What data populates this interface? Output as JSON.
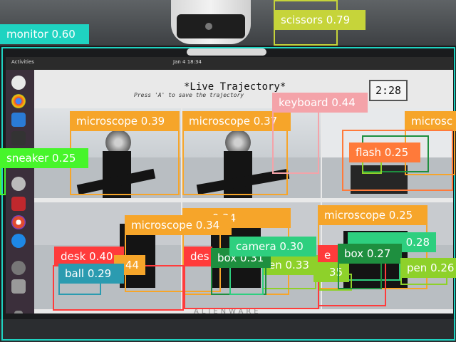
{
  "scene": {
    "live_title": "*Live Trajectory*",
    "live_subtitle": "Press 'A' to save the trajectory",
    "timer": "2:28",
    "topbar_left": "Activities",
    "topbar_clock": "Jan 4  18:34",
    "laptop_brand": "ALIENWARE"
  },
  "colors": {
    "monitor": "#1fd3c1",
    "scissors": "#c6d43a",
    "microscope": "#f6a52a",
    "keyboard": "#f4a3a9",
    "sneaker": "#47f52b",
    "flash": "#ff7a3a",
    "desk": "#ff3b3b",
    "ball": "#2b9bb0",
    "box": "#1e8f3f",
    "camera": "#2ecf7f",
    "pen": "#8ed12a"
  },
  "detections": [
    {
      "id": "monitor",
      "label": "monitor 0.60",
      "class": "monitor"
    },
    {
      "id": "scissors",
      "label": "scissors 0.79",
      "class": "scissors"
    },
    {
      "id": "microscope-1",
      "label": "microscope 0.39",
      "class": "microscope"
    },
    {
      "id": "microscope-2",
      "label": "microscope 0.37",
      "class": "microscope"
    },
    {
      "id": "keyboard",
      "label": "keyboard 0.44",
      "class": "keyboard"
    },
    {
      "id": "microscope-3",
      "label": "microsc",
      "class": "microscope"
    },
    {
      "id": "sneaker",
      "label": "sneaker 0.25",
      "class": "sneaker"
    },
    {
      "id": "flash",
      "label": "flash 0.25",
      "class": "flash"
    },
    {
      "id": "microscope-4",
      "label": "ope 0.34",
      "class": "microscope"
    },
    {
      "id": "microscope-5",
      "label": "microscope 0.25",
      "class": "microscope"
    },
    {
      "id": "microscope-6",
      "label": "microscope 0.34",
      "class": "microscope"
    },
    {
      "id": "camera-1",
      "label": "camera 0.30",
      "class": "camera"
    },
    {
      "id": "camera-2",
      "label": "0.28",
      "class": "camera"
    },
    {
      "id": "desk-1",
      "label": "desk 0.40",
      "class": "desk"
    },
    {
      "id": "microscope-7",
      "label": "44",
      "class": "microscope"
    },
    {
      "id": "desk-2",
      "label": "des",
      "class": "desk"
    },
    {
      "id": "box-1",
      "label": "box 0.31",
      "class": "box"
    },
    {
      "id": "pen-1",
      "label": "en 0.33",
      "class": "pen"
    },
    {
      "id": "desk-3",
      "label": "e",
      "class": "desk"
    },
    {
      "id": "pen-2",
      "label": "35",
      "class": "pen"
    },
    {
      "id": "box-2",
      "label": "box 0.27",
      "class": "box"
    },
    {
      "id": "pen-3",
      "label": "pen 0.26",
      "class": "pen"
    },
    {
      "id": "ball",
      "label": "ball 0.29",
      "class": "ball"
    }
  ]
}
